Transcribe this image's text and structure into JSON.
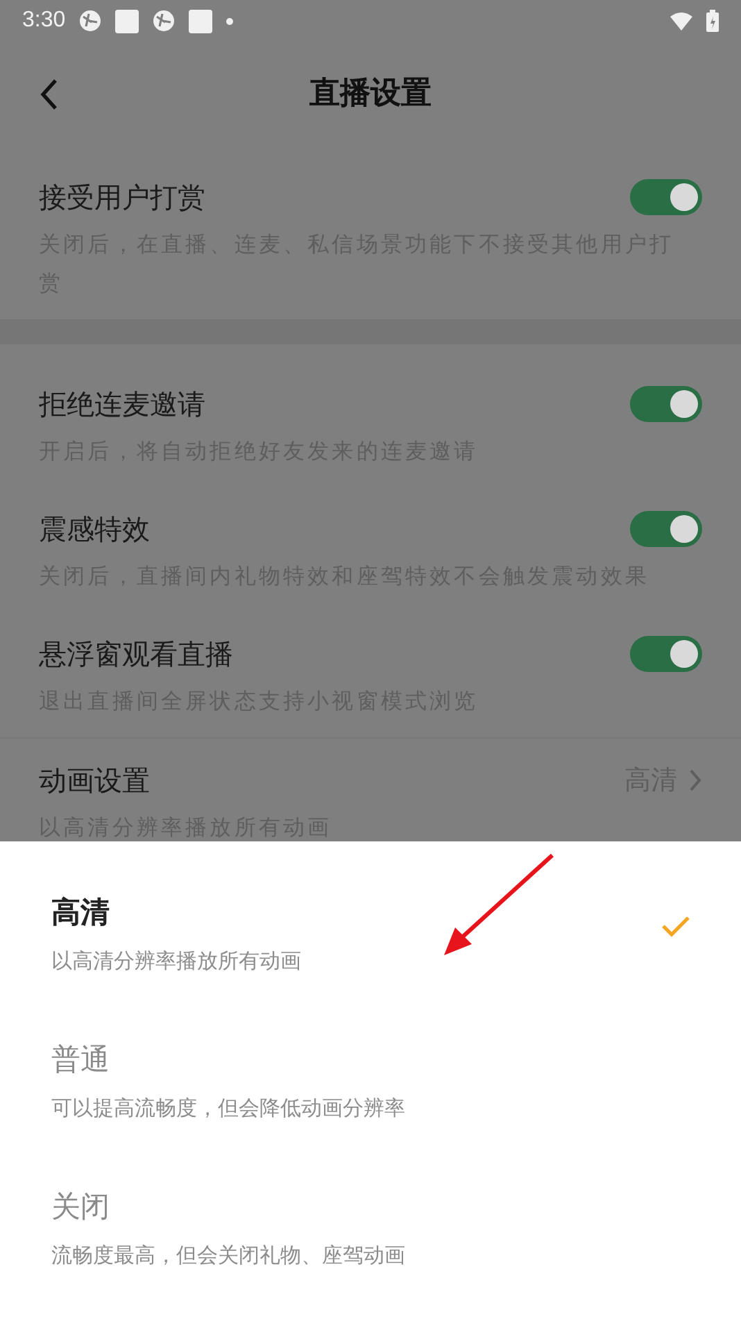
{
  "status_bar": {
    "time": "3:30"
  },
  "header": {
    "title": "直播设置"
  },
  "settings": [
    {
      "kind": "toggle",
      "title": "接受用户打赏",
      "description": "关闭后，在直播、连麦、私信场景功能下不接受其他用户打赏",
      "on": true
    },
    {
      "kind": "toggle",
      "title": "拒绝连麦邀请",
      "description": "开启后，将自动拒绝好友发来的连麦邀请",
      "on": true
    },
    {
      "kind": "toggle",
      "title": "震感特效",
      "description": "关闭后，直播间内礼物特效和座驾特效不会触发震动效果",
      "on": true
    },
    {
      "kind": "toggle",
      "title": "悬浮窗观看直播",
      "description": "退出直播间全屏状态支持小视窗模式浏览",
      "on": true
    },
    {
      "kind": "link",
      "title": "动画设置",
      "description": "以高清分辨率播放所有动画",
      "value": "高清"
    }
  ],
  "sheet": {
    "options": [
      {
        "label": "高清",
        "description": "以高清分辨率播放所有动画",
        "selected": true
      },
      {
        "label": "普通",
        "description": "可以提高流畅度，但会降低动画分辨率",
        "selected": false
      },
      {
        "label": "关闭",
        "description": "流畅度最高，但会关闭礼物、座驾动画",
        "selected": false
      }
    ]
  }
}
